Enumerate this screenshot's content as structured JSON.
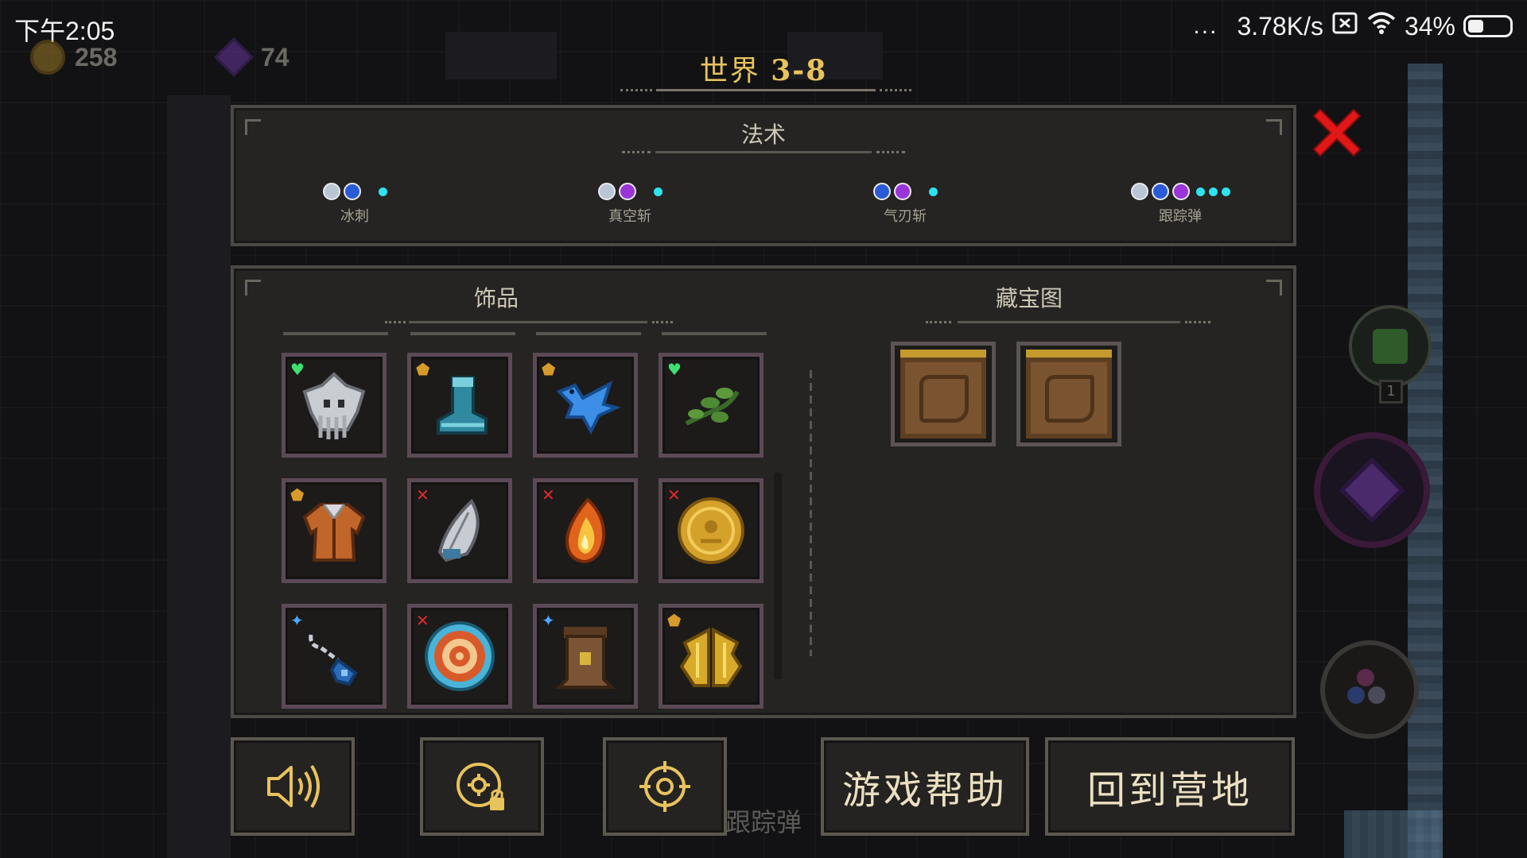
{
  "status_bar": {
    "time": "下午2:05",
    "dots": "...",
    "net_speed": "3.78K/s",
    "battery": "34%"
  },
  "currency": {
    "gold": "258",
    "gems": "74"
  },
  "world": {
    "label": "世界",
    "level": "3-8"
  },
  "spells": {
    "title": "法术",
    "items": [
      {
        "name": "冰刺",
        "runes": [
          "white",
          "blue"
        ],
        "extra": 1
      },
      {
        "name": "真空斩",
        "runes": [
          "white",
          "purple"
        ],
        "extra": 1
      },
      {
        "name": "气刃斩",
        "runes": [
          "blue",
          "purple"
        ],
        "extra": 1
      },
      {
        "name": "跟踪弹",
        "runes": [
          "white",
          "blue",
          "purple"
        ],
        "extra": 3
      }
    ]
  },
  "accessories": {
    "title": "饰品",
    "items": [
      {
        "icon": "skull-helmet-icon",
        "badge": "heart"
      },
      {
        "icon": "boot-icon",
        "badge": "shield"
      },
      {
        "icon": "blue-bird-icon",
        "badge": "shield"
      },
      {
        "icon": "herb-sprig-icon",
        "badge": "heart"
      },
      {
        "icon": "leather-armor-icon",
        "badge": "shield"
      },
      {
        "icon": "silver-feather-icon",
        "badge": "cursed"
      },
      {
        "icon": "fire-crystal-icon",
        "badge": "cursed"
      },
      {
        "icon": "gold-coin-icon",
        "badge": "cursed"
      },
      {
        "icon": "pendant-chain-icon",
        "badge": "spark"
      },
      {
        "icon": "target-shield-icon",
        "badge": "cursed"
      },
      {
        "icon": "scroll-icon",
        "badge": "spark"
      },
      {
        "icon": "golden-wings-icon",
        "badge": "shield"
      }
    ]
  },
  "treasure_maps": {
    "title": "藏宝图",
    "count": 2
  },
  "buttons": {
    "help": "游戏帮助",
    "camp": "回到营地"
  },
  "background_text": "跟踪弹",
  "side_badge": "1",
  "colors": {
    "gold_text": "#e8c35c",
    "panel_bg": "#252422",
    "panel_border": "#4c4944",
    "close_red": "#e01818",
    "spell_cyan": "#2ee2f2"
  }
}
